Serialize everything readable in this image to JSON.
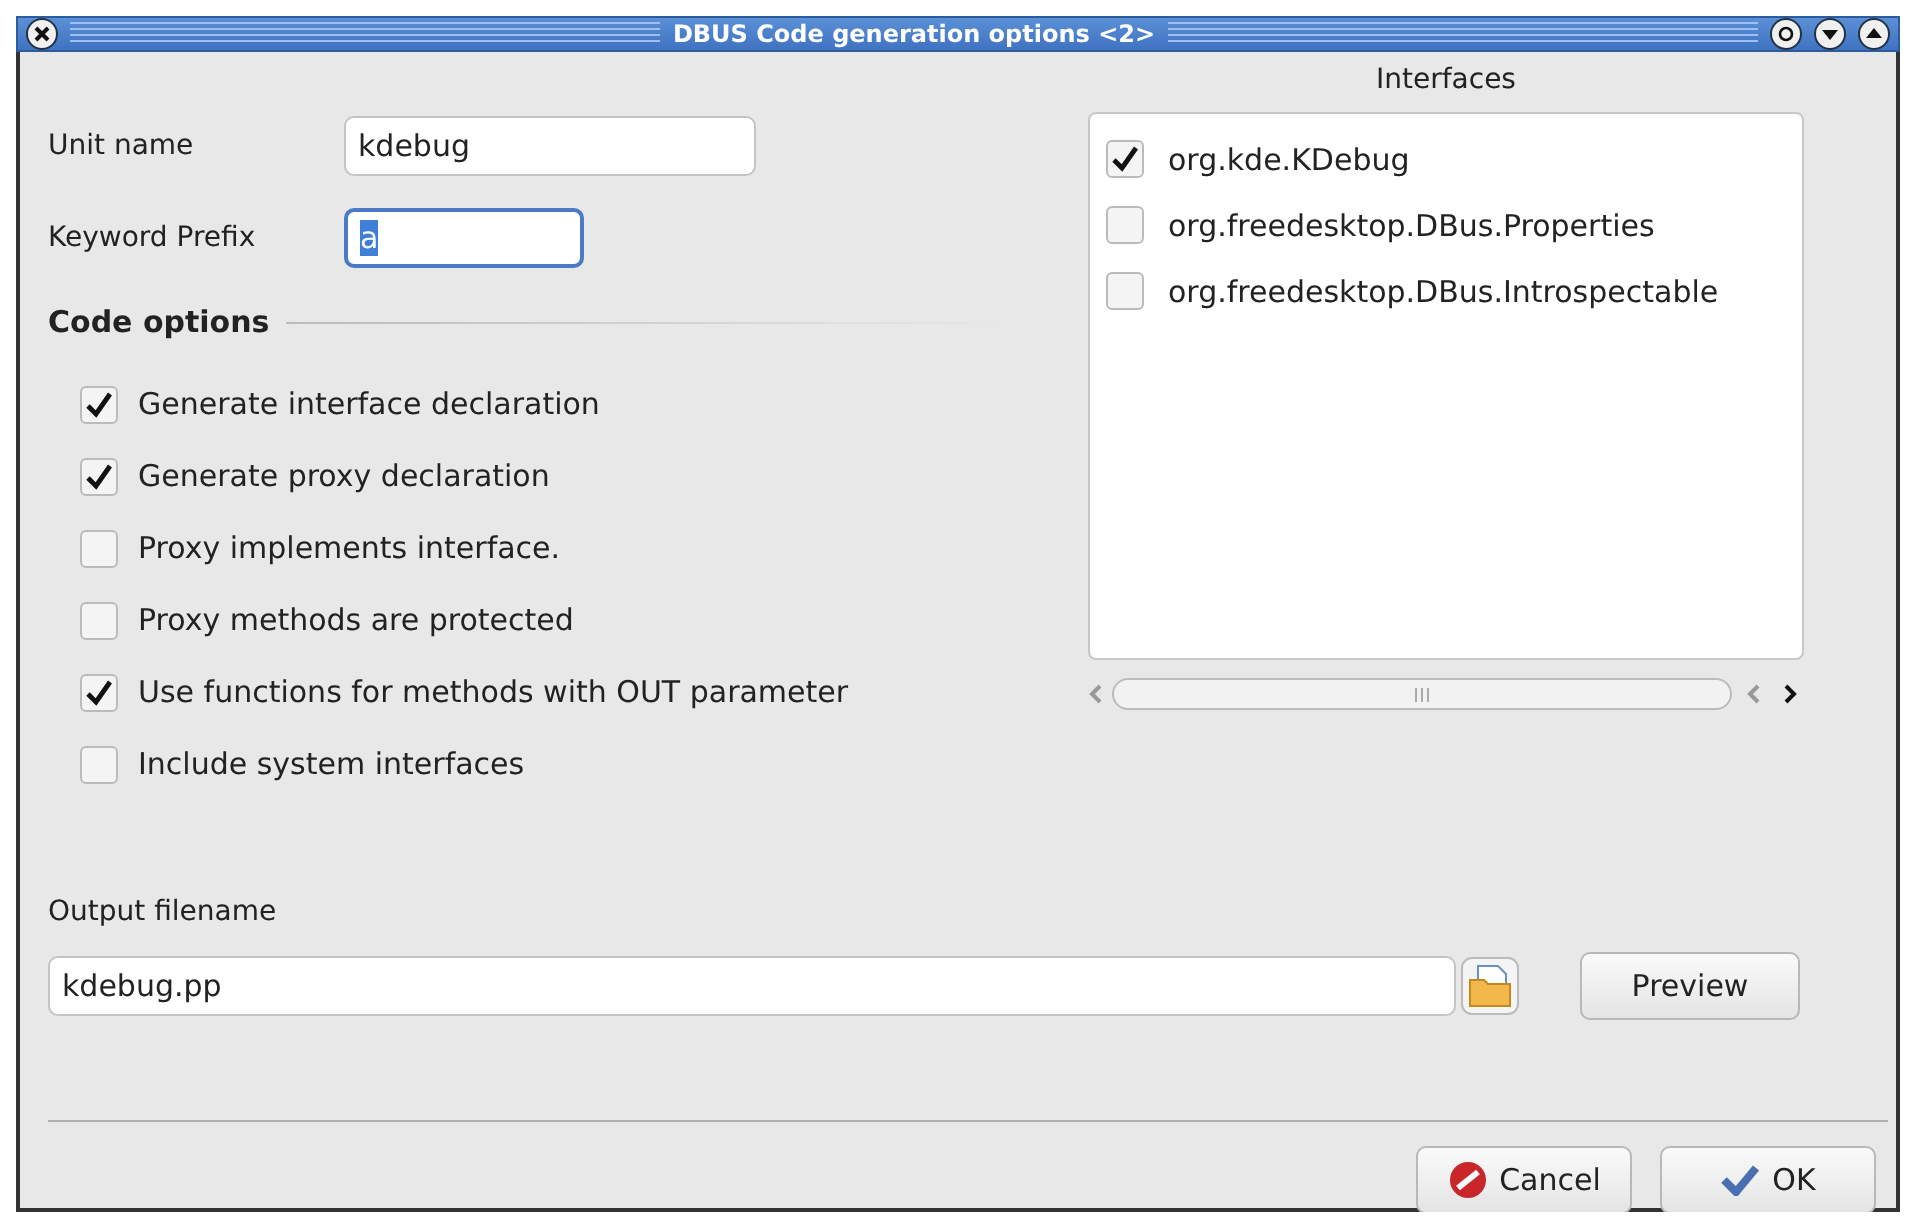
{
  "window": {
    "title": "DBUS Code generation options <2>"
  },
  "unit_name": {
    "label": "Unit name",
    "value": "kdebug"
  },
  "keyword_prefix": {
    "label": "Keyword Prefix",
    "value": "a",
    "focused": true
  },
  "code_options": {
    "title": "Code options",
    "items": [
      {
        "label": "Generate interface declaration",
        "checked": true
      },
      {
        "label": "Generate proxy declaration",
        "checked": true
      },
      {
        "label": "Proxy implements interface.",
        "checked": false
      },
      {
        "label": "Proxy methods are protected",
        "checked": false
      },
      {
        "label": "Use functions for methods with OUT parameter",
        "checked": true
      },
      {
        "label": "Include system interfaces",
        "checked": false
      }
    ]
  },
  "interfaces": {
    "title": "Interfaces",
    "items": [
      {
        "label": "org.kde.KDebug",
        "checked": true
      },
      {
        "label": "org.freedesktop.DBus.Properties",
        "checked": false
      },
      {
        "label": "org.freedesktop.DBus.Introspectable",
        "checked": false
      }
    ]
  },
  "output": {
    "label": "Output filename",
    "value": "kdebug.pp",
    "preview": "Preview"
  },
  "buttons": [
    {
      "label": "Cancel",
      "kind": "cancel"
    },
    {
      "label": "OK",
      "kind": "ok"
    }
  ]
}
